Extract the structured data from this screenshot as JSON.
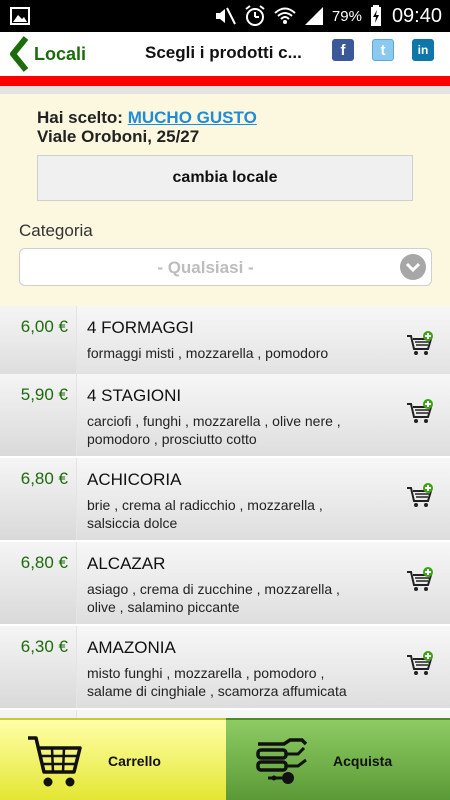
{
  "status_bar": {
    "battery": "79%",
    "time": "09:40",
    "icons": [
      "gallery-icon",
      "mute-icon",
      "alarm-icon",
      "wifi-icon",
      "signal-icon",
      "battery-icon"
    ]
  },
  "header": {
    "back_label": "Locali",
    "title": "Scegli i prodotti c...",
    "social": [
      "f",
      "t",
      "in"
    ],
    "accent_color": "#ff0000",
    "brand_green": "#1d6b0c"
  },
  "selection": {
    "chosen_prefix": "Hai scelto:",
    "shop_name": "MUCHO GUSTO",
    "address": "Viale Oroboni, 25/27",
    "change_button": "cambia locale",
    "category_label": "Categoria",
    "category_value": "- Qualsiasi -"
  },
  "products": [
    {
      "price": "6,00 €",
      "name": "4 FORMAGGI",
      "desc": "formaggi misti , mozzarella , pomodoro"
    },
    {
      "price": "5,90 €",
      "name": "4 STAGIONI",
      "desc": "carciofi , funghi , mozzarella , olive nere , pomodoro , prosciutto cotto"
    },
    {
      "price": "6,80 €",
      "name": "ACHICORIA",
      "desc": "brie , crema al radicchio , mozzarella , salsiccia dolce"
    },
    {
      "price": "6,80 €",
      "name": "ALCAZAR",
      "desc": "asiago , crema di zucchine , mozzarella , olive , salamino piccante"
    },
    {
      "price": "6,30 €",
      "name": "AMAZONIA",
      "desc": "misto funghi , mozzarella , pomodoro , salame di cinghiale , scamorza affumicata"
    }
  ],
  "bottom_bar": {
    "cart_label": "Carrello",
    "buy_label": "Acquista"
  }
}
